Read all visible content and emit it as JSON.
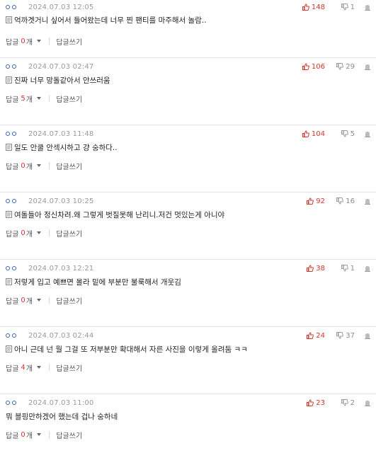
{
  "reply_label": "답글",
  "reply_unit": "개",
  "write_label": "답글쓰기",
  "separator": "|",
  "comments": [
    {
      "date": "2024.07.03 12:05",
      "likes": "148",
      "dislikes": "1",
      "text": "억까겟거니 싶어서 들어왔는데 너무 찐 팬티를 마주해서 놀람..",
      "has_doc_icon": true,
      "replies": "0"
    },
    {
      "date": "2024.07.03 02:47",
      "likes": "106",
      "dislikes": "29",
      "text": "진짜 너무 망돌같아서 안쓰러움",
      "has_doc_icon": true,
      "replies": "5"
    },
    {
      "date": "2024.07.03 11:48",
      "likes": "104",
      "dislikes": "5",
      "text": "일도 안쿨 안섹시하고 걍 숭하다..",
      "has_doc_icon": true,
      "replies": "0"
    },
    {
      "date": "2024.07.03 10:25",
      "likes": "92",
      "dislikes": "16",
      "text": "여돌들아 정신차려.왜 그렇게 벗질못해 난리니.저건 멋있는게 아니야",
      "has_doc_icon": true,
      "replies": "0"
    },
    {
      "date": "2024.07.03 12:21",
      "likes": "38",
      "dislikes": "1",
      "text": "저렇게 입고 예쁘면 몰라 밑에 부분만 불룩해서 개웃김",
      "has_doc_icon": true,
      "replies": "0"
    },
    {
      "date": "2024.07.03 02:44",
      "likes": "24",
      "dislikes": "37",
      "text": "아니 근데 넌 뭘 그걸 또 저부분만 확대해서 자른 사진을 이렇게 올려둠 ㅋㅋ",
      "has_doc_icon": true,
      "replies": "4"
    },
    {
      "date": "2024.07.03 11:00",
      "likes": "23",
      "dislikes": "2",
      "text": "뭐 블핑만하겠어 했는데 겁나 숭하네",
      "has_doc_icon": false,
      "replies": "0"
    }
  ],
  "colors": {
    "accent": "#d9342b",
    "nick": "#3b63b8",
    "muted": "#999999"
  },
  "icons": {
    "like": "thumbs-up-icon",
    "dislike": "thumbs-down-icon",
    "report": "report-icon",
    "doc": "document-icon"
  }
}
